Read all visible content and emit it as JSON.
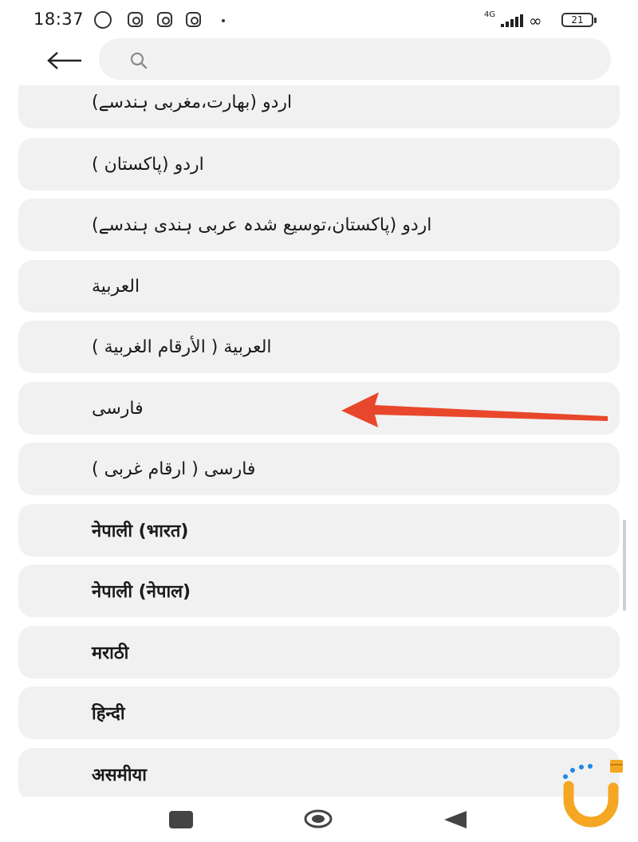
{
  "status_bar": {
    "time": "18:37",
    "network_type": "4G",
    "battery_level": "21"
  },
  "search": {
    "placeholder": ""
  },
  "language_list": [
    {
      "label": "اردو (بھارت،مغربی ہندسے)"
    },
    {
      "label": "اردو (پاکستان )"
    },
    {
      "label": "اردو (پاکستان،توسیع شدہ عربی ہندی ہندسے)"
    },
    {
      "label": "العربية"
    },
    {
      "label": "العربية ( الأرقام الغربية )"
    },
    {
      "label": "فارسی"
    },
    {
      "label": "فارسی ( ارقام غربی )"
    },
    {
      "label": "नेपाली (भारत)"
    },
    {
      "label": "नेपाली (नेपाल)"
    },
    {
      "label": "मराठी"
    },
    {
      "label": "हिन्दी"
    },
    {
      "label": "असमीया"
    }
  ],
  "annotation": {
    "arrow_color": "#e8472b",
    "points_to": "فارسی"
  },
  "colors": {
    "item_background": "#f1f1f1",
    "search_background": "#f2f2f2",
    "widget_orange": "#f5a623",
    "widget_blue": "#1e88e5"
  }
}
